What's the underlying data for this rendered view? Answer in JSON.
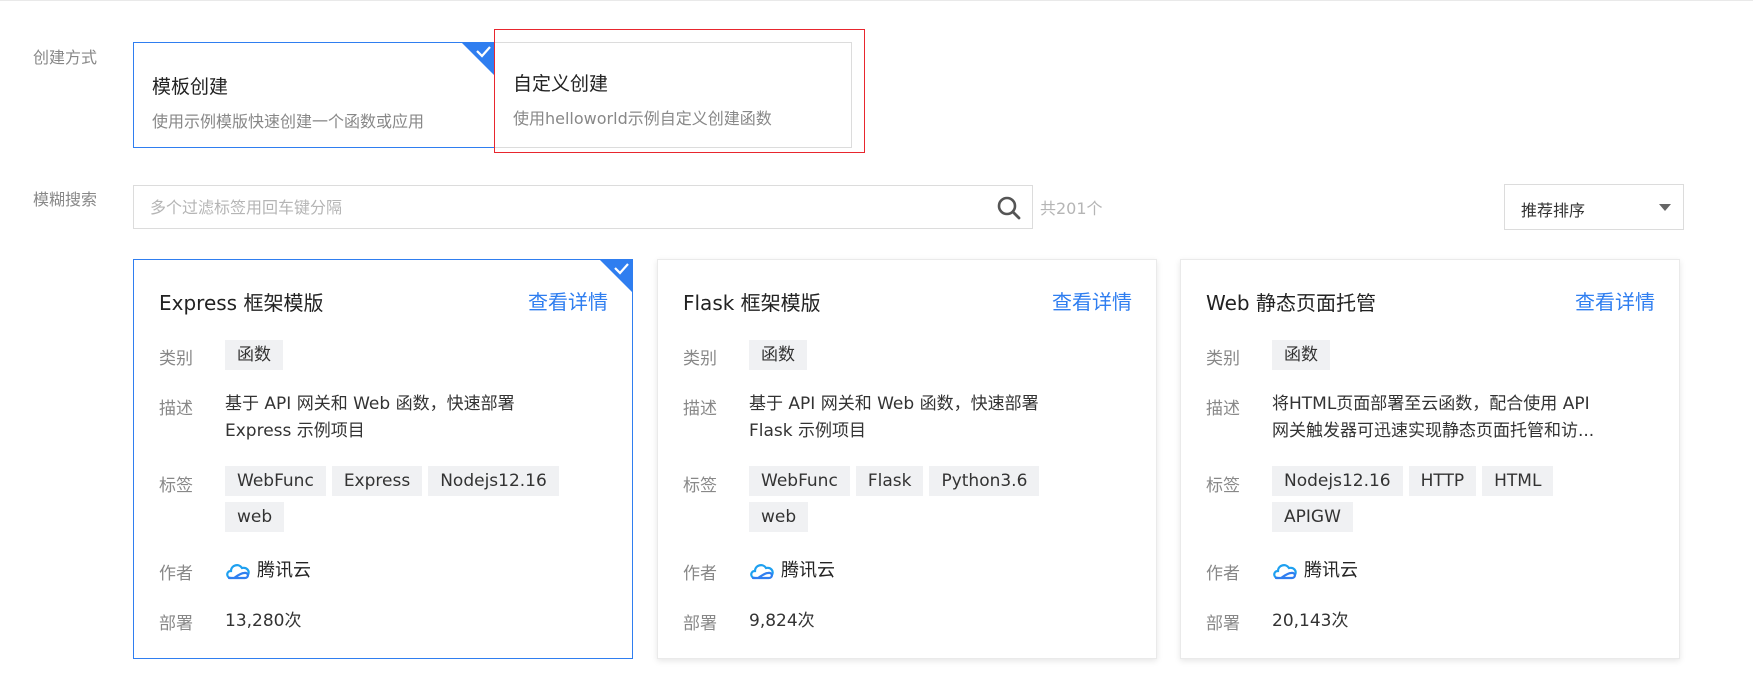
{
  "labels": {
    "create_method": "创建方式",
    "fuzzy_search": "模糊搜索"
  },
  "create_modes": [
    {
      "title": "模板创建",
      "desc": "使用示例模版快速创建一个函数或应用"
    },
    {
      "title": "自定义创建",
      "desc": "使用helloworld示例自定义创建函数"
    }
  ],
  "search": {
    "placeholder": "多个过滤标签用回车键分隔",
    "count": "共201个"
  },
  "sort": {
    "value": "推荐排序"
  },
  "field_labels": {
    "category": "类别",
    "description": "描述",
    "tags": "标签",
    "author": "作者",
    "deploy": "部署"
  },
  "templates": [
    {
      "title": "Express 框架模版",
      "detail": "查看详情",
      "category": "函数",
      "desc": "基于 API 网关和 Web 函数，快速部署 Express 示例项目",
      "tags": [
        "WebFunc",
        "Express",
        "Nodejs12.16",
        "web"
      ],
      "author": "腾讯云",
      "deploy": "13,280次"
    },
    {
      "title": "Flask 框架模版",
      "detail": "查看详情",
      "category": "函数",
      "desc": "基于 API 网关和 Web 函数，快速部署 Flask 示例项目",
      "tags": [
        "WebFunc",
        "Flask",
        "Python3.6",
        "web"
      ],
      "author": "腾讯云",
      "deploy": "9,824次"
    },
    {
      "title": "Web 静态页面托管",
      "detail": "查看详情",
      "category": "函数",
      "desc": "将HTML页面部署至云函数，配合使用 API 网关触发器可迅速实现静态页面托管和访...",
      "tags": [
        "Nodejs12.16",
        "HTTP",
        "HTML",
        "APIGW"
      ],
      "author": "腾讯云",
      "deploy": "20,143次"
    }
  ],
  "colors": {
    "accent": "#2f7ef0",
    "highlight": "#e8262e"
  },
  "icons": {
    "selected_corner": "check-corner-icon",
    "search": "search-icon",
    "author_logo": "tencent-cloud-icon"
  }
}
